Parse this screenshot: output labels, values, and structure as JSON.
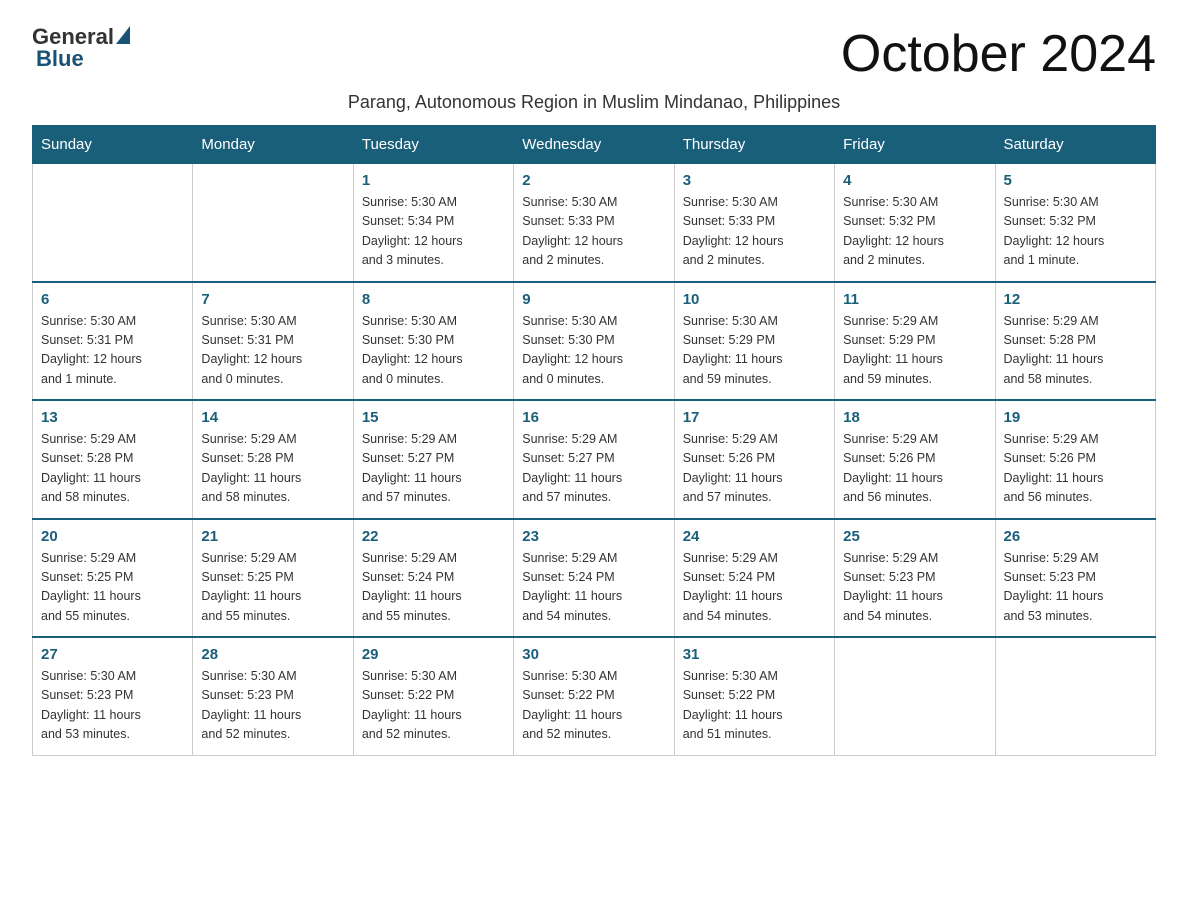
{
  "header": {
    "logo_text_general": "General",
    "logo_text_blue": "Blue",
    "month_title": "October 2024",
    "subtitle": "Parang, Autonomous Region in Muslim Mindanao, Philippines"
  },
  "weekdays": [
    "Sunday",
    "Monday",
    "Tuesday",
    "Wednesday",
    "Thursday",
    "Friday",
    "Saturday"
  ],
  "weeks": [
    [
      {
        "day": "",
        "info": ""
      },
      {
        "day": "",
        "info": ""
      },
      {
        "day": "1",
        "info": "Sunrise: 5:30 AM\nSunset: 5:34 PM\nDaylight: 12 hours\nand 3 minutes."
      },
      {
        "day": "2",
        "info": "Sunrise: 5:30 AM\nSunset: 5:33 PM\nDaylight: 12 hours\nand 2 minutes."
      },
      {
        "day": "3",
        "info": "Sunrise: 5:30 AM\nSunset: 5:33 PM\nDaylight: 12 hours\nand 2 minutes."
      },
      {
        "day": "4",
        "info": "Sunrise: 5:30 AM\nSunset: 5:32 PM\nDaylight: 12 hours\nand 2 minutes."
      },
      {
        "day": "5",
        "info": "Sunrise: 5:30 AM\nSunset: 5:32 PM\nDaylight: 12 hours\nand 1 minute."
      }
    ],
    [
      {
        "day": "6",
        "info": "Sunrise: 5:30 AM\nSunset: 5:31 PM\nDaylight: 12 hours\nand 1 minute."
      },
      {
        "day": "7",
        "info": "Sunrise: 5:30 AM\nSunset: 5:31 PM\nDaylight: 12 hours\nand 0 minutes."
      },
      {
        "day": "8",
        "info": "Sunrise: 5:30 AM\nSunset: 5:30 PM\nDaylight: 12 hours\nand 0 minutes."
      },
      {
        "day": "9",
        "info": "Sunrise: 5:30 AM\nSunset: 5:30 PM\nDaylight: 12 hours\nand 0 minutes."
      },
      {
        "day": "10",
        "info": "Sunrise: 5:30 AM\nSunset: 5:29 PM\nDaylight: 11 hours\nand 59 minutes."
      },
      {
        "day": "11",
        "info": "Sunrise: 5:29 AM\nSunset: 5:29 PM\nDaylight: 11 hours\nand 59 minutes."
      },
      {
        "day": "12",
        "info": "Sunrise: 5:29 AM\nSunset: 5:28 PM\nDaylight: 11 hours\nand 58 minutes."
      }
    ],
    [
      {
        "day": "13",
        "info": "Sunrise: 5:29 AM\nSunset: 5:28 PM\nDaylight: 11 hours\nand 58 minutes."
      },
      {
        "day": "14",
        "info": "Sunrise: 5:29 AM\nSunset: 5:28 PM\nDaylight: 11 hours\nand 58 minutes."
      },
      {
        "day": "15",
        "info": "Sunrise: 5:29 AM\nSunset: 5:27 PM\nDaylight: 11 hours\nand 57 minutes."
      },
      {
        "day": "16",
        "info": "Sunrise: 5:29 AM\nSunset: 5:27 PM\nDaylight: 11 hours\nand 57 minutes."
      },
      {
        "day": "17",
        "info": "Sunrise: 5:29 AM\nSunset: 5:26 PM\nDaylight: 11 hours\nand 57 minutes."
      },
      {
        "day": "18",
        "info": "Sunrise: 5:29 AM\nSunset: 5:26 PM\nDaylight: 11 hours\nand 56 minutes."
      },
      {
        "day": "19",
        "info": "Sunrise: 5:29 AM\nSunset: 5:26 PM\nDaylight: 11 hours\nand 56 minutes."
      }
    ],
    [
      {
        "day": "20",
        "info": "Sunrise: 5:29 AM\nSunset: 5:25 PM\nDaylight: 11 hours\nand 55 minutes."
      },
      {
        "day": "21",
        "info": "Sunrise: 5:29 AM\nSunset: 5:25 PM\nDaylight: 11 hours\nand 55 minutes."
      },
      {
        "day": "22",
        "info": "Sunrise: 5:29 AM\nSunset: 5:24 PM\nDaylight: 11 hours\nand 55 minutes."
      },
      {
        "day": "23",
        "info": "Sunrise: 5:29 AM\nSunset: 5:24 PM\nDaylight: 11 hours\nand 54 minutes."
      },
      {
        "day": "24",
        "info": "Sunrise: 5:29 AM\nSunset: 5:24 PM\nDaylight: 11 hours\nand 54 minutes."
      },
      {
        "day": "25",
        "info": "Sunrise: 5:29 AM\nSunset: 5:23 PM\nDaylight: 11 hours\nand 54 minutes."
      },
      {
        "day": "26",
        "info": "Sunrise: 5:29 AM\nSunset: 5:23 PM\nDaylight: 11 hours\nand 53 minutes."
      }
    ],
    [
      {
        "day": "27",
        "info": "Sunrise: 5:30 AM\nSunset: 5:23 PM\nDaylight: 11 hours\nand 53 minutes."
      },
      {
        "day": "28",
        "info": "Sunrise: 5:30 AM\nSunset: 5:23 PM\nDaylight: 11 hours\nand 52 minutes."
      },
      {
        "day": "29",
        "info": "Sunrise: 5:30 AM\nSunset: 5:22 PM\nDaylight: 11 hours\nand 52 minutes."
      },
      {
        "day": "30",
        "info": "Sunrise: 5:30 AM\nSunset: 5:22 PM\nDaylight: 11 hours\nand 52 minutes."
      },
      {
        "day": "31",
        "info": "Sunrise: 5:30 AM\nSunset: 5:22 PM\nDaylight: 11 hours\nand 51 minutes."
      },
      {
        "day": "",
        "info": ""
      },
      {
        "day": "",
        "info": ""
      }
    ]
  ]
}
